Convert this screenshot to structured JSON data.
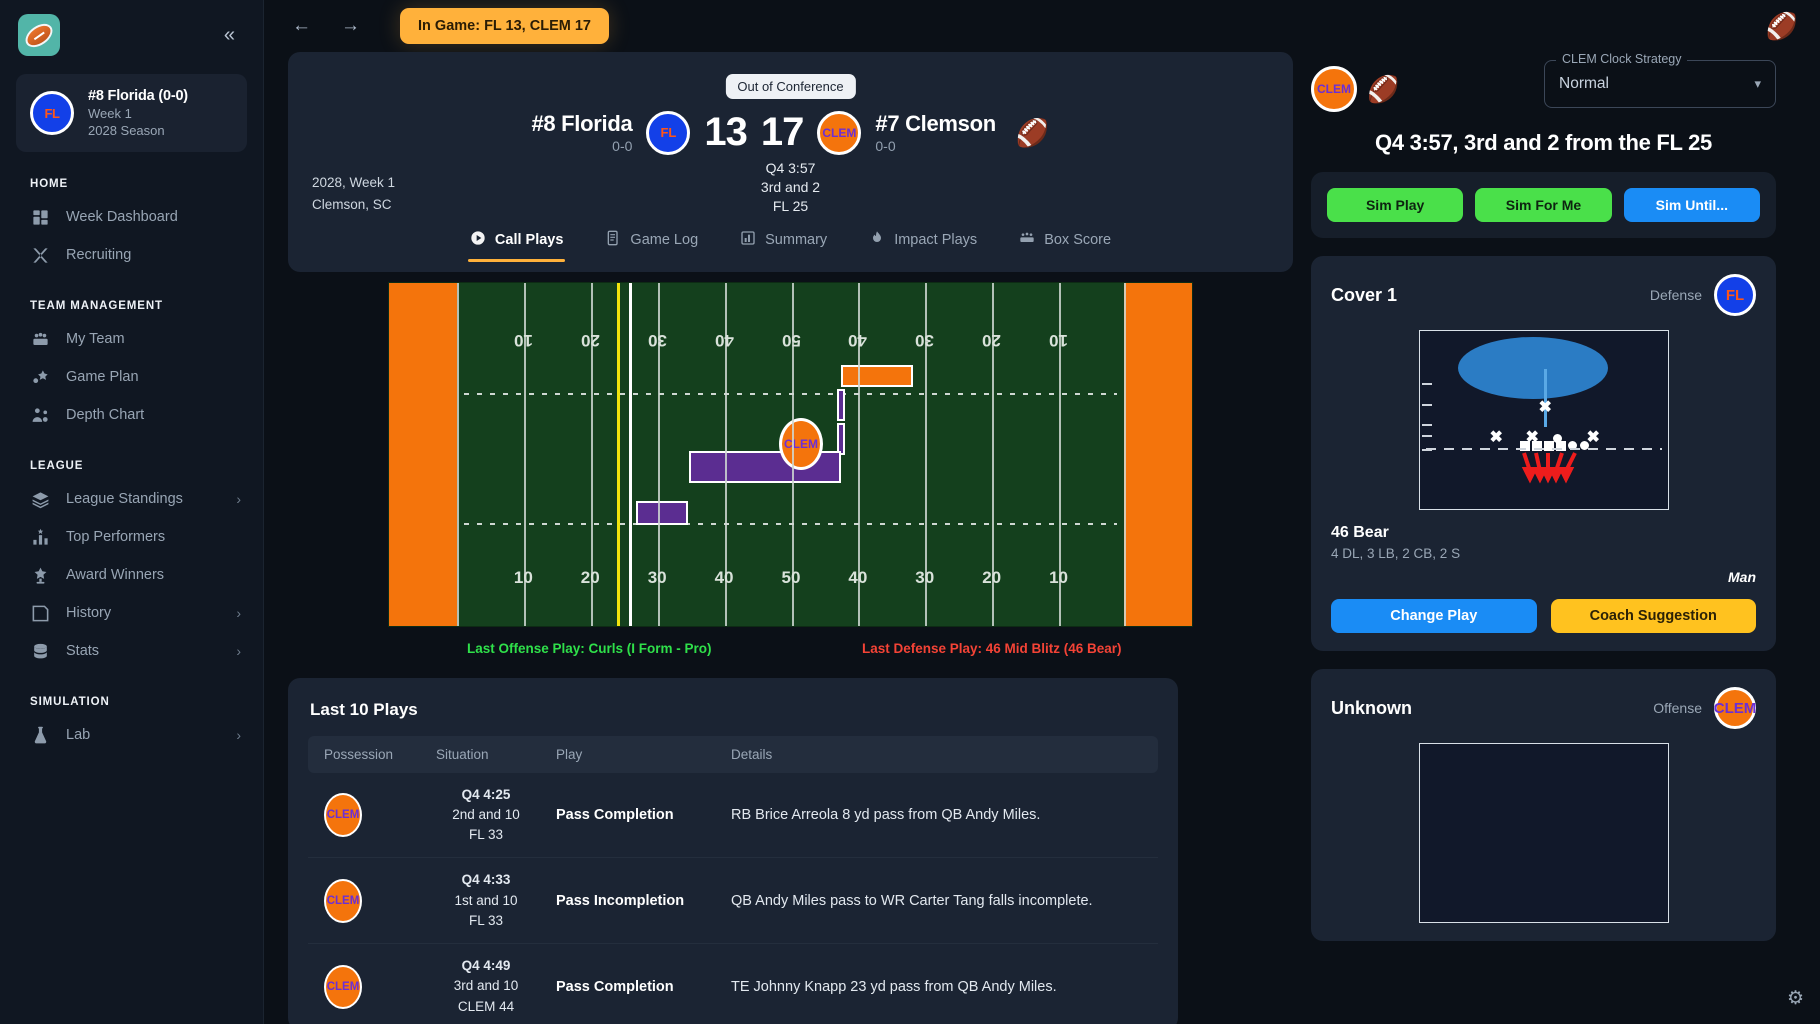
{
  "sidebar": {
    "logo_icon": "football-logo-icon",
    "collapse_icon": "collapse-left-icon",
    "team": {
      "abbr": "FL",
      "name": "#8 Florida (0-0)",
      "week": "Week 1",
      "season": "2028 Season"
    },
    "sections": [
      {
        "label": "HOME",
        "items": [
          {
            "label": "Week Dashboard",
            "icon": "dashboard-icon",
            "chevron": false
          },
          {
            "label": "Recruiting",
            "icon": "recruiting-icon",
            "chevron": false
          }
        ]
      },
      {
        "label": "TEAM MANAGEMENT",
        "items": [
          {
            "label": "My Team",
            "icon": "team-icon",
            "chevron": false
          },
          {
            "label": "Game Plan",
            "icon": "game-plan-icon",
            "chevron": false
          },
          {
            "label": "Depth Chart",
            "icon": "depth-chart-icon",
            "chevron": false
          }
        ]
      },
      {
        "label": "LEAGUE",
        "items": [
          {
            "label": "League Standings",
            "icon": "layers-icon",
            "chevron": true
          },
          {
            "label": "Top Performers",
            "icon": "bar-chart-star-icon",
            "chevron": false
          },
          {
            "label": "Award Winners",
            "icon": "trophy-star-icon",
            "chevron": false
          },
          {
            "label": "History",
            "icon": "history-icon",
            "chevron": true
          },
          {
            "label": "Stats",
            "icon": "database-icon",
            "chevron": true
          }
        ]
      },
      {
        "label": "SIMULATION",
        "items": [
          {
            "label": "Lab",
            "icon": "lab-flask-icon",
            "chevron": true
          }
        ]
      }
    ]
  },
  "topbar": {
    "back_icon": "arrow-left-icon",
    "forward_icon": "arrow-right-icon",
    "ingame_badge": "In Game: FL 13, CLEM 17",
    "ball_icon": "football-icon"
  },
  "scoreboard": {
    "conference_pill": "Out of Conference",
    "away": {
      "name": "#8 Florida",
      "record": "0-0",
      "abbr": "FL",
      "score": "13"
    },
    "home": {
      "name": "#7 Clemson",
      "record": "0-0",
      "abbr": "CLEM",
      "score": "17"
    },
    "clock": "Q4 3:57",
    "down": "3rd and 2",
    "spot": "FL 25",
    "meta_line1": "2028, Week 1",
    "meta_line2": "Clemson, SC",
    "ball_icon": "football-icon",
    "tabs": [
      {
        "label": "Call Plays",
        "icon": "play-circle-icon",
        "active": true
      },
      {
        "label": "Game Log",
        "icon": "log-icon",
        "active": false
      },
      {
        "label": "Summary",
        "icon": "chart-icon",
        "active": false
      },
      {
        "label": "Impact Plays",
        "icon": "flame-icon",
        "active": false
      },
      {
        "label": "Box Score",
        "icon": "box-score-icon",
        "active": false
      }
    ]
  },
  "field": {
    "yard_numbers_top": [
      "10",
      "20",
      "30",
      "40",
      "50",
      "40",
      "30",
      "20",
      "10"
    ],
    "yard_numbers_bottom": [
      "10",
      "20",
      "30",
      "40",
      "50",
      "40",
      "30",
      "20",
      "10"
    ],
    "ball_carrier_label": "CLEM",
    "last_offense_play": "Last Offense Play: Curls (I Form - Pro)",
    "last_defense_play": "Last Defense Play: 46 Mid Blitz (46 Bear)"
  },
  "plays_panel": {
    "title": "Last 10 Plays",
    "columns": [
      "Possession",
      "Situation",
      "Play",
      "Details"
    ],
    "rows": [
      {
        "possession": "CLEM",
        "time": "Q4 4:25",
        "down": "2nd and 10",
        "spot": "FL 33",
        "play": "Pass Completion",
        "details": "RB Brice Arreola 8 yd pass from QB Andy Miles."
      },
      {
        "possession": "CLEM",
        "time": "Q4 4:33",
        "down": "1st and 10",
        "spot": "FL 33",
        "play": "Pass Incompletion",
        "details": "QB Andy Miles pass to WR Carter Tang falls incomplete."
      },
      {
        "possession": "CLEM",
        "time": "Q4 4:49",
        "down": "3rd and 10",
        "spot": "CLEM 44",
        "play": "Pass Completion",
        "details": "TE Johnny Knapp 23 yd pass from QB Andy Miles."
      }
    ]
  },
  "right_panel": {
    "possession_abbr": "CLEM",
    "ball_icon": "football-icon",
    "clock_strategy_label": "CLEM Clock Strategy",
    "clock_strategy_value": "Normal",
    "situation_headline": "Q4 3:57, 3rd and 2 from the FL 25",
    "sim_buttons": [
      {
        "label": "Sim Play",
        "style": "green"
      },
      {
        "label": "Sim For Me",
        "style": "green"
      },
      {
        "label": "Sim Until...",
        "style": "blue"
      }
    ],
    "defense_card": {
      "play_name": "Cover 1",
      "side_label": "Defense",
      "team_abbr": "FL",
      "formation": "46 Bear",
      "personnel": "4 DL, 3 LB, 2 CB, 2 S",
      "coverage": "Man",
      "buttons": [
        {
          "label": "Change Play",
          "style": "blue"
        },
        {
          "label": "Coach Suggestion",
          "style": "yellow"
        }
      ]
    },
    "offense_card": {
      "play_name": "Unknown",
      "side_label": "Offense",
      "team_abbr": "CLEM"
    },
    "settings_icon": "gear-icon"
  }
}
